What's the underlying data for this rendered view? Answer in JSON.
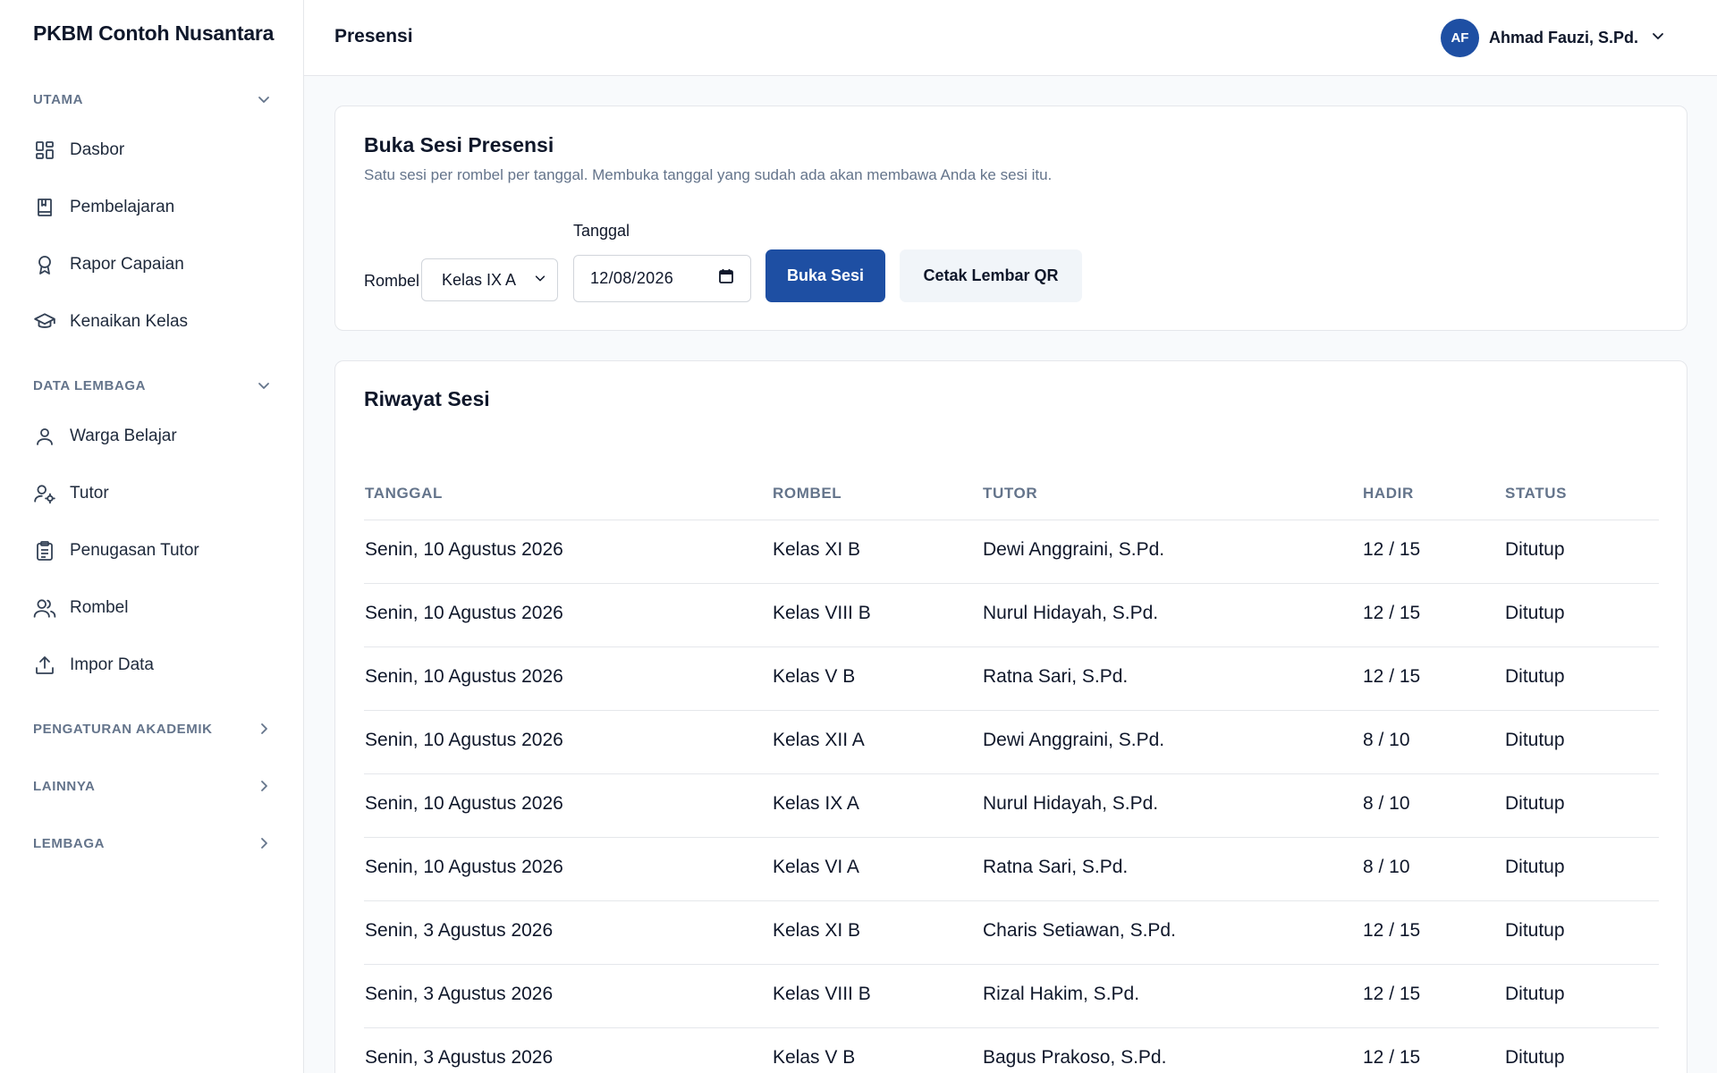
{
  "brand": "PKBM Contoh Nusantara",
  "sidebar": {
    "sections": [
      {
        "label": "UTAMA",
        "items": [
          {
            "label": "Dasbor",
            "icon": "dashboard-icon"
          },
          {
            "label": "Pembelajaran",
            "icon": "book-icon"
          },
          {
            "label": "Rapor Capaian",
            "icon": "award-icon"
          },
          {
            "label": "Kenaikan Kelas",
            "icon": "graduation-cap-icon"
          }
        ]
      },
      {
        "label": "DATA LEMBAGA",
        "items": [
          {
            "label": "Warga Belajar",
            "icon": "user-icon"
          },
          {
            "label": "Tutor",
            "icon": "user-gear-icon"
          },
          {
            "label": "Penugasan Tutor",
            "icon": "clipboard-icon"
          },
          {
            "label": "Rombel",
            "icon": "users-icon"
          },
          {
            "label": "Impor Data",
            "icon": "upload-icon"
          }
        ]
      },
      {
        "label": "PENGATURAN AKADEMIK"
      },
      {
        "label": "LAINNYA"
      },
      {
        "label": "LEMBAGA"
      }
    ]
  },
  "header": {
    "title": "Presensi",
    "user_initials": "AF",
    "user_name": "Ahmad Fauzi, S.Pd."
  },
  "open_session": {
    "title": "Buka Sesi Presensi",
    "subtitle": "Satu sesi per rombel per tanggal. Membuka tanggal yang sudah ada akan membawa Anda ke sesi itu.",
    "rombel_label": "Rombel",
    "rombel_value": "Kelas IX A",
    "date_label": "Tanggal",
    "date_value": "12/08/2026",
    "open_button": "Buka Sesi",
    "print_button": "Cetak Lembar QR"
  },
  "history": {
    "title": "Riwayat Sesi",
    "columns": [
      "TANGGAL",
      "ROMBEL",
      "TUTOR",
      "HADIR",
      "STATUS"
    ],
    "rows": [
      [
        "Senin, 10 Agustus 2026",
        "Kelas XI B",
        "Dewi Anggraini, S.Pd.",
        "12 / 15",
        "Ditutup"
      ],
      [
        "Senin, 10 Agustus 2026",
        "Kelas VIII B",
        "Nurul Hidayah, S.Pd.",
        "12 / 15",
        "Ditutup"
      ],
      [
        "Senin, 10 Agustus 2026",
        "Kelas V B",
        "Ratna Sari, S.Pd.",
        "12 / 15",
        "Ditutup"
      ],
      [
        "Senin, 10 Agustus 2026",
        "Kelas XII A",
        "Dewi Anggraini, S.Pd.",
        "8 / 10",
        "Ditutup"
      ],
      [
        "Senin, 10 Agustus 2026",
        "Kelas IX A",
        "Nurul Hidayah, S.Pd.",
        "8 / 10",
        "Ditutup"
      ],
      [
        "Senin, 10 Agustus 2026",
        "Kelas VI A",
        "Ratna Sari, S.Pd.",
        "8 / 10",
        "Ditutup"
      ],
      [
        "Senin, 3 Agustus 2026",
        "Kelas XI B",
        "Charis Setiawan, S.Pd.",
        "12 / 15",
        "Ditutup"
      ],
      [
        "Senin, 3 Agustus 2026",
        "Kelas VIII B",
        "Rizal Hakim, S.Pd.",
        "12 / 15",
        "Ditutup"
      ],
      [
        "Senin, 3 Agustus 2026",
        "Kelas V B",
        "Bagus Prakoso, S.Pd.",
        "12 / 15",
        "Ditutup"
      ]
    ]
  },
  "colors": {
    "primary": "#1e4fa3",
    "muted_text": "#64748b",
    "border": "#e5e7eb"
  }
}
